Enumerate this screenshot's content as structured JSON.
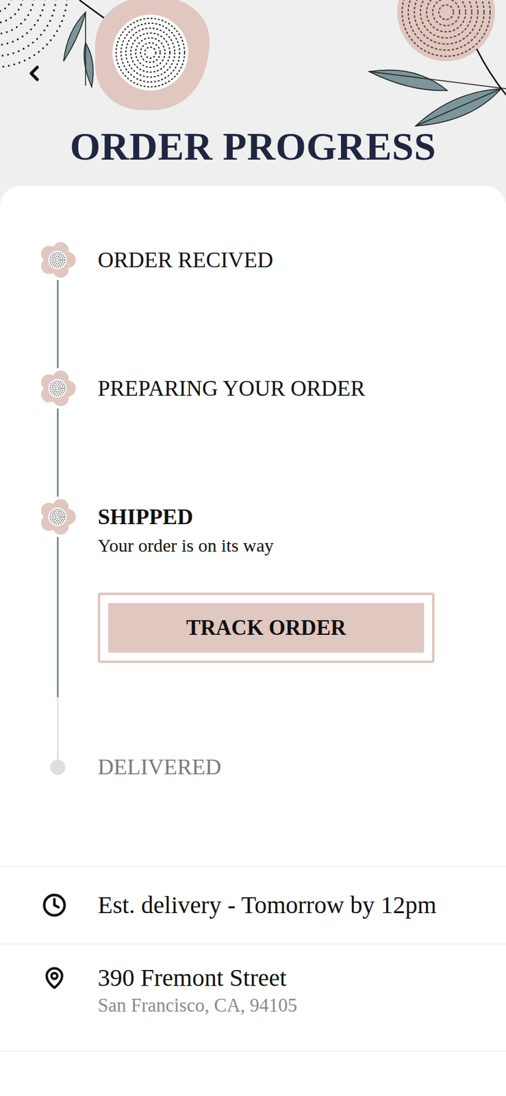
{
  "header": {
    "title": "ORDER PROGRESS"
  },
  "steps": [
    {
      "label": "ORDER RECIVED",
      "completed": true,
      "current": false
    },
    {
      "label": "PREPARING YOUR ORDER",
      "completed": true,
      "current": false
    },
    {
      "label": "SHIPPED",
      "completed": true,
      "current": true,
      "detail": "Your order is on its way",
      "action": "TRACK ORDER"
    },
    {
      "label": "DELIVERED",
      "completed": false,
      "current": false
    }
  ],
  "delivery": {
    "estimate": "Est. delivery - Tomorrow by 12pm"
  },
  "address": {
    "street": "390 Fremont Street",
    "city": "San Francisco, CA, 94105"
  }
}
